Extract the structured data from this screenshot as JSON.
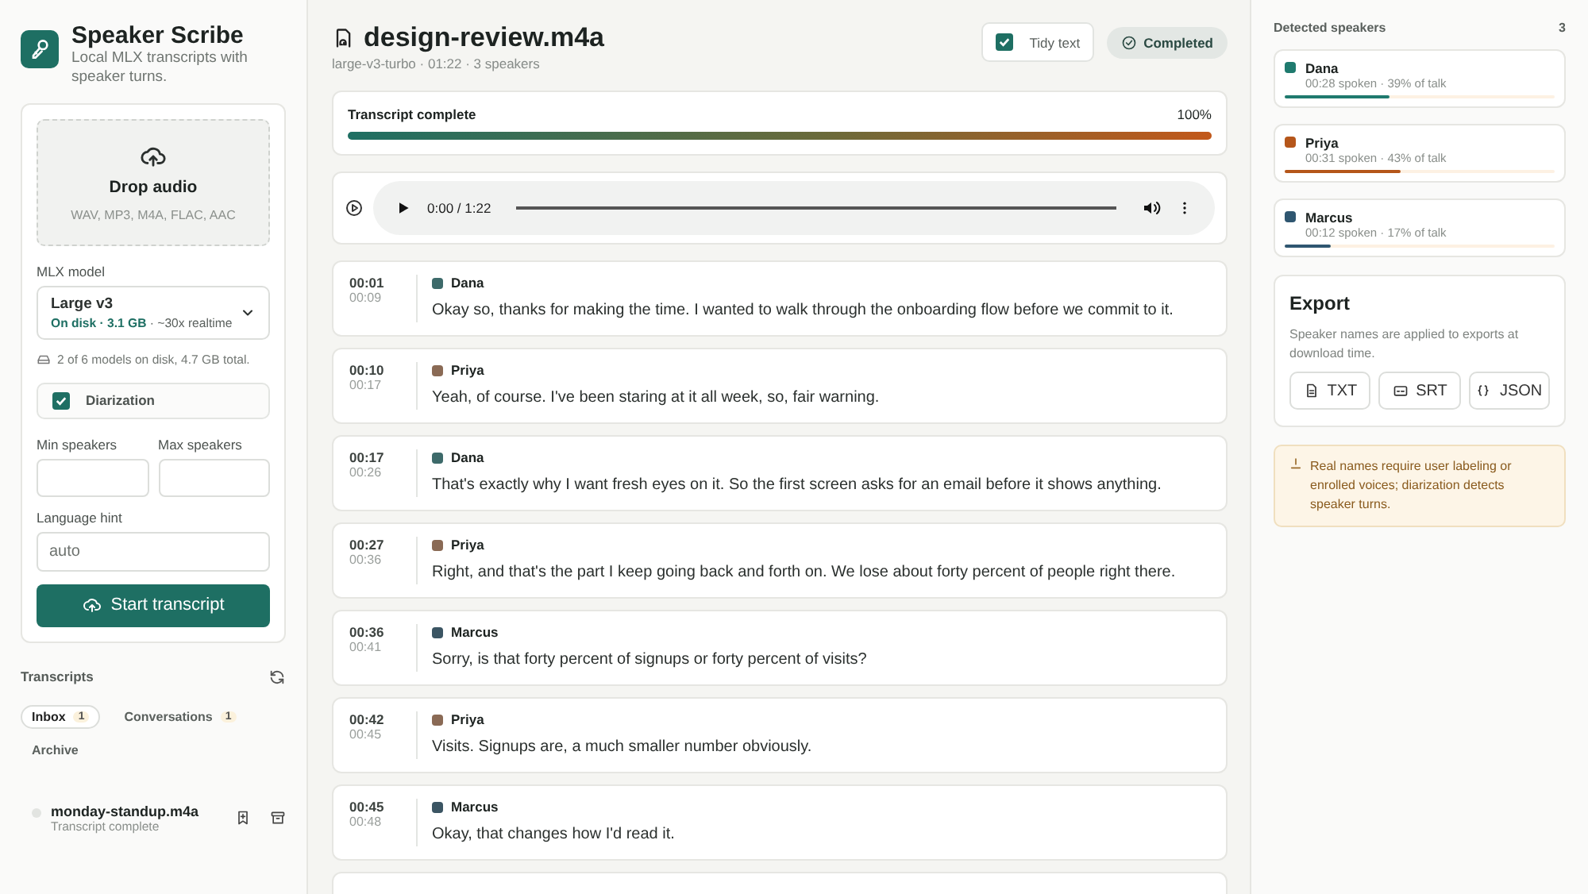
{
  "app": {
    "title": "Speaker Scribe",
    "subtitle": "Local MLX transcripts with speaker turns."
  },
  "upload": {
    "title": "Drop audio",
    "formats": "WAV, MP3, M4A, FLAC, AAC"
  },
  "model": {
    "label": "MLX model",
    "name": "Large v3",
    "status": "On disk · 3.1 GB",
    "detail": " · ~30x realtime",
    "disk_note": "2 of 6 models on disk, 4.7 GB total."
  },
  "diarization": {
    "label": "Diarization",
    "checked": true
  },
  "min_speakers": {
    "label": "Min speakers"
  },
  "max_speakers": {
    "label": "Max speakers"
  },
  "language": {
    "label": "Language hint",
    "placeholder": "auto"
  },
  "start_button": "Start transcript",
  "transcripts": {
    "title": "Transcripts",
    "tabs": [
      {
        "label": "Inbox",
        "count": "1",
        "selected": true
      },
      {
        "label": "Conversations",
        "count": "1",
        "selected": false
      },
      {
        "label": "Archive",
        "selected": false
      }
    ],
    "items": [
      {
        "name": "monday-standup.m4a",
        "status": "Transcript complete"
      }
    ]
  },
  "file": {
    "title": "design-review.m4a",
    "meta": "large-v3-turbo · 01:22 · 3 speakers"
  },
  "tidy_text": {
    "label": "Tidy text",
    "checked": true
  },
  "status_badge": "Completed",
  "progress": {
    "label": "Transcript complete",
    "reading": "100%",
    "level": 1
  },
  "player": {
    "time": "0:00 / 1:22"
  },
  "segments": [
    {
      "start": "00:01",
      "end": "00:09",
      "speaker": "Dana",
      "color": "#3d6a6a",
      "text": "Okay so, thanks for making the time. I wanted to walk through the onboarding flow before we commit to it."
    },
    {
      "start": "00:10",
      "end": "00:17",
      "speaker": "Priya",
      "color": "#8a6a55",
      "text": "Yeah, of course. I've been staring at it all week, so, fair warning."
    },
    {
      "start": "00:17",
      "end": "00:26",
      "speaker": "Dana",
      "color": "#3d6a6a",
      "text": "That's exactly why I want fresh eyes on it. So the first screen asks for an email before it shows anything."
    },
    {
      "start": "00:27",
      "end": "00:36",
      "speaker": "Priya",
      "color": "#8a6a55",
      "text": "Right, and that's the part I keep going back and forth on. We lose about forty percent of people right there."
    },
    {
      "start": "00:36",
      "end": "00:41",
      "speaker": "Marcus",
      "color": "#3b5563",
      "text": "Sorry, is that forty percent of signups or forty percent of visits?"
    },
    {
      "start": "00:42",
      "end": "00:45",
      "speaker": "Priya",
      "color": "#8a6a55",
      "text": "Visits. Signups are, a much smaller number obviously."
    },
    {
      "start": "00:45",
      "end": "00:48",
      "speaker": "Marcus",
      "color": "#3b5563",
      "text": "Okay, that changes how I'd read it."
    }
  ],
  "speakers": {
    "title": "Detected speakers",
    "count": "3",
    "items": [
      {
        "name": "Dana",
        "stats": "00:28 spoken · 39% of talk",
        "color": "#1f7a6e",
        "level": 0.39
      },
      {
        "name": "Priya",
        "stats": "00:31 spoken · 43% of talk",
        "color": "#b5561a",
        "level": 0.43
      },
      {
        "name": "Marcus",
        "stats": "00:12 spoken · 17% of talk",
        "color": "#2f5670",
        "level": 0.17
      }
    ]
  },
  "export": {
    "title": "Export",
    "note": "Speaker names are applied to exports at download time.",
    "buttons": [
      {
        "label": "TXT",
        "kind": "file"
      },
      {
        "label": "SRT",
        "kind": "captions"
      },
      {
        "label": "JSON",
        "kind": "code"
      }
    ]
  },
  "notice": "Real names require user labeling or enrolled voices; diarization detects speaker turns."
}
